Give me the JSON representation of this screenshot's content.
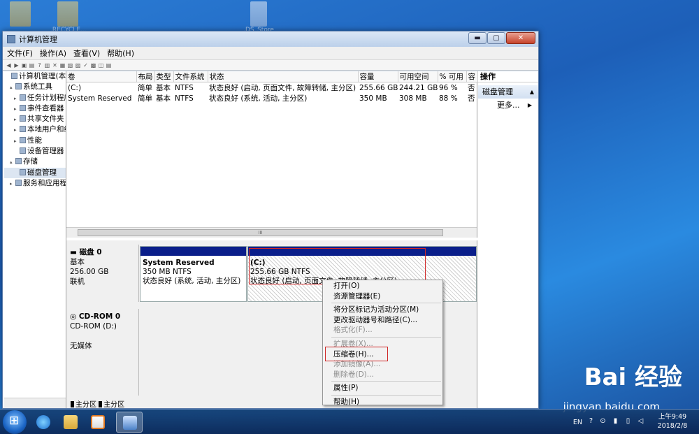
{
  "desktop": {
    "icons": [
      {
        "label": ""
      },
      {
        "label": ".RECYCLE..."
      },
      {
        "label": ".DS_Store"
      }
    ]
  },
  "window": {
    "title": "计算机管理",
    "controls": {
      "minimize": "▬",
      "maximize": "▢",
      "close": "✕"
    }
  },
  "menu": [
    "文件(F)",
    "操作(A)",
    "查看(V)",
    "帮助(H)"
  ],
  "tree": {
    "items": [
      {
        "label": "计算机管理(本地)",
        "level": 0,
        "expand": ""
      },
      {
        "label": "系统工具",
        "level": 1,
        "expand": "▴"
      },
      {
        "label": "任务计划程序",
        "level": 2,
        "expand": "▸"
      },
      {
        "label": "事件查看器",
        "level": 2,
        "expand": "▸"
      },
      {
        "label": "共享文件夹",
        "level": 2,
        "expand": "▸"
      },
      {
        "label": "本地用户和组",
        "level": 2,
        "expand": "▸"
      },
      {
        "label": "性能",
        "level": 2,
        "expand": "▸"
      },
      {
        "label": "设备管理器",
        "level": 2,
        "expand": ""
      },
      {
        "label": "存储",
        "level": 1,
        "expand": "▴"
      },
      {
        "label": "磁盘管理",
        "level": 2,
        "expand": "",
        "selected": true
      },
      {
        "label": "服务和应用程序",
        "level": 1,
        "expand": "▸"
      }
    ]
  },
  "volumes": {
    "columns": [
      "卷",
      "布局",
      "类型",
      "文件系统",
      "状态",
      "容量",
      "可用空间",
      "% 可用",
      "容"
    ],
    "rows": [
      [
        "(C:)",
        "简单",
        "基本",
        "NTFS",
        "状态良好 (启动, 页面文件, 故障转储, 主分区)",
        "255.66 GB",
        "244.21 GB",
        "96 %",
        "否"
      ],
      [
        "System Reserved",
        "简单",
        "基本",
        "NTFS",
        "状态良好 (系统, 活动, 主分区)",
        "350 MB",
        "308 MB",
        "88 %",
        "否"
      ]
    ],
    "scroll_thumb": "III"
  },
  "disks": [
    {
      "name": "磁盘 0",
      "type": "基本",
      "size": "256.00 GB",
      "status": "联机"
    },
    {
      "name": "CD-ROM 0",
      "type": "CD-ROM (D:)",
      "size": "",
      "status": "无媒体"
    }
  ],
  "partitions": [
    {
      "title": "System Reserved",
      "fs": "350 MB NTFS",
      "status": "状态良好 (系统, 活动, 主分区)"
    },
    {
      "title": "(C:)",
      "fs": "255.66 GB NTFS",
      "status": "状态良好 (启动, 页面文件, 故障转储, 主分区)"
    }
  ],
  "legend": [
    "主分区",
    "主分区"
  ],
  "actions": {
    "header": "操作",
    "group": "磁盘管理",
    "more": "更多..."
  },
  "context_menu": [
    {
      "label": "打开(O)",
      "disabled": false
    },
    {
      "label": "资源管理器(E)",
      "disabled": false
    },
    {
      "sep": true
    },
    {
      "label": "将分区标记为活动分区(M)",
      "disabled": false
    },
    {
      "label": "更改驱动器号和路径(C)...",
      "disabled": false
    },
    {
      "label": "格式化(F)...",
      "disabled": true
    },
    {
      "sep": true
    },
    {
      "label": "扩展卷(X)...",
      "disabled": true
    },
    {
      "label": "压缩卷(H)...",
      "disabled": false
    },
    {
      "label": "添加镜像(A)...",
      "disabled": true
    },
    {
      "label": "删除卷(D)...",
      "disabled": true
    },
    {
      "sep": true
    },
    {
      "label": "属性(P)",
      "disabled": false
    },
    {
      "sep": true
    },
    {
      "label": "帮助(H)",
      "disabled": false
    }
  ],
  "taskbar": {
    "lang": "EN",
    "time": "上午9:49",
    "date": "2018/2/8"
  },
  "watermark": {
    "brand": "Bai 经验",
    "url": "jingyan.baidu.com"
  }
}
